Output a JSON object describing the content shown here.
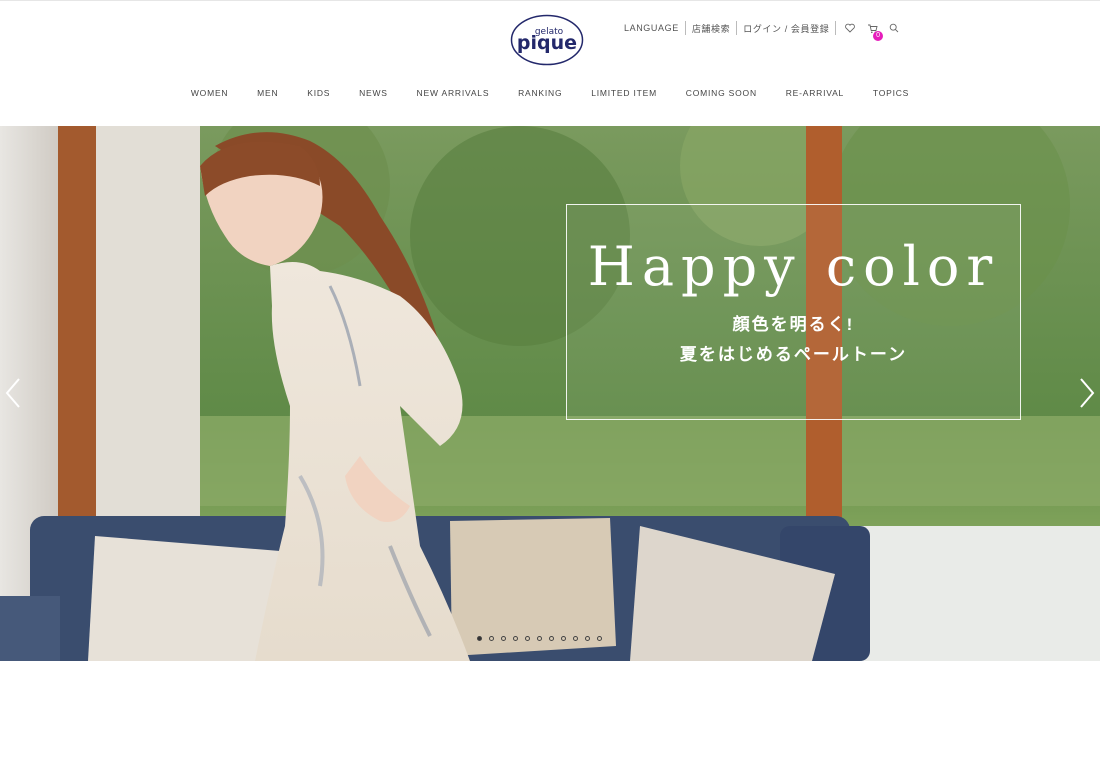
{
  "brand": {
    "logo_top": "gelato",
    "logo_main": "pique",
    "color": "#23286b"
  },
  "utility_nav": {
    "language": "LANGUAGE",
    "store_search": "店舗検索",
    "login": "ログイン / 会員登録",
    "favorites_icon": "heart-icon",
    "cart_icon": "cart-icon",
    "cart_count": "0",
    "search_icon": "search-icon"
  },
  "main_nav": {
    "items": [
      "WOMEN",
      "MEN",
      "KIDS",
      "NEWS",
      "NEW ARRIVALS",
      "RANKING",
      "LIMITED ITEM",
      "COMING SOON",
      "RE-ARRIVAL",
      "TOPICS"
    ]
  },
  "hero": {
    "title": "Happy color",
    "subtitle_line1": "顔色を明るく!",
    "subtitle_line2": "夏をはじめるペールトーン",
    "prev_icon": "chevron-left-icon",
    "next_icon": "chevron-right-icon",
    "slide_count": 11,
    "active_slide": 1
  },
  "colors": {
    "accent_badge": "#e61dbb"
  }
}
